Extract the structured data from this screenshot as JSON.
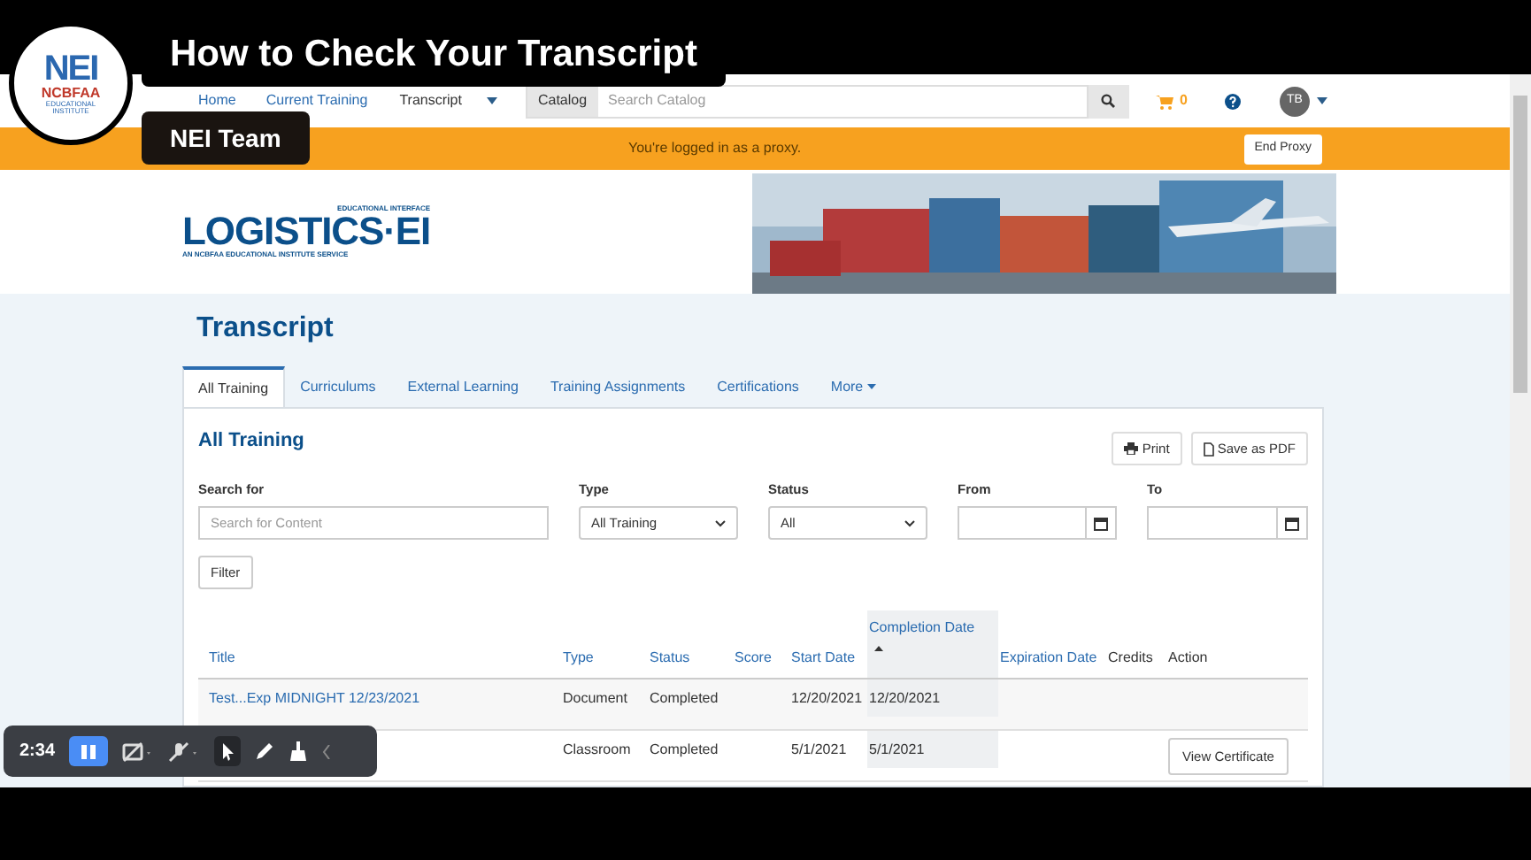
{
  "video_overlay": {
    "title": "How to Check Your Transcript",
    "presenter": "NEI Team",
    "logo_letters": "NEI",
    "logo_name": "NCBFAA",
    "logo_line_1": "EDUCATIONAL",
    "logo_line_2": "INSTITUTE"
  },
  "nav": {
    "items": [
      {
        "label": "Home"
      },
      {
        "label": "Current Training"
      },
      {
        "label": "Transcript"
      }
    ],
    "catalog_button": "Catalog",
    "search_placeholder": "Search Catalog",
    "cart_count": "0",
    "avatar": "TB"
  },
  "proxy_bar": {
    "message": "You're logged in as a proxy.",
    "button": "End Proxy"
  },
  "banner": {
    "logo_top": "EDUCATIONAL INTERFACE",
    "logo": "LOGISTICS·EI",
    "logo_bottom": "AN NCBFAA EDUCATIONAL INSTITUTE SERVICE"
  },
  "page_title": "Transcript",
  "tabs": [
    {
      "label": "All Training",
      "selected": true
    },
    {
      "label": "Curriculums",
      "selected": false
    },
    {
      "label": "External Learning",
      "selected": false
    },
    {
      "label": "Training Assignments",
      "selected": false
    },
    {
      "label": "Certifications",
      "selected": false
    },
    {
      "label": "More",
      "selected": false
    }
  ],
  "card": {
    "title": "All Training",
    "buttons": [
      "Print",
      "Save as PDF"
    ],
    "filters": [
      {
        "label": "Search for",
        "kind": "text",
        "placeholder": "Search for Content"
      },
      {
        "label": "Type",
        "kind": "select",
        "value": "All Training"
      },
      {
        "label": "Status",
        "kind": "select",
        "value": "All"
      },
      {
        "label": "From",
        "kind": "date"
      },
      {
        "label": "To",
        "kind": "date"
      }
    ],
    "filter_button": "Filter",
    "table": {
      "columns": [
        {
          "label": "Title",
          "sortable": true,
          "sorted": false
        },
        {
          "label": "Type",
          "sortable": true,
          "sorted": false
        },
        {
          "label": "Status",
          "sortable": true,
          "sorted": false
        },
        {
          "label": "Score",
          "sortable": true,
          "sorted": false
        },
        {
          "label": "Start Date",
          "sortable": true,
          "sorted": false
        },
        {
          "label": "Completion Date",
          "sortable": true,
          "sorted": true
        },
        {
          "label": "Expiration Date",
          "sortable": true,
          "sorted": false
        },
        {
          "label": "Credits",
          "sortable": false,
          "sorted": false
        },
        {
          "label": "Action",
          "sortable": false,
          "sorted": false
        }
      ],
      "rows": [
        {
          "title": "Test...Exp MIDNIGHT 12/23/2021",
          "type": "Document",
          "status": "Completed",
          "start_date": "12/20/2021",
          "completion_date": "12/20/2021"
        },
        {
          "type": "Classroom",
          "status": "Completed",
          "start_date": "5/1/2021",
          "completion_date": "5/1/2021",
          "action": "View Certificate"
        }
      ]
    }
  },
  "recorder_toolbar": {
    "time": "2:34"
  }
}
